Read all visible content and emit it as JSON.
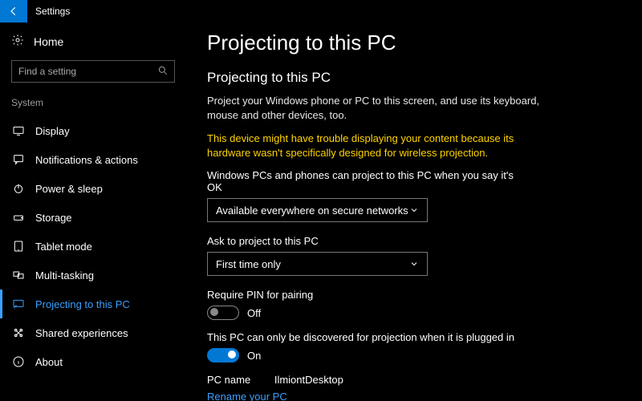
{
  "titlebar": {
    "app_title": "Settings"
  },
  "sidebar": {
    "home_label": "Home",
    "search_placeholder": "Find a setting",
    "category_label": "System",
    "items": [
      {
        "label": "Display"
      },
      {
        "label": "Notifications & actions"
      },
      {
        "label": "Power & sleep"
      },
      {
        "label": "Storage"
      },
      {
        "label": "Tablet mode"
      },
      {
        "label": "Multi-tasking"
      },
      {
        "label": "Projecting to this PC"
      },
      {
        "label": "Shared experiences"
      },
      {
        "label": "About"
      }
    ]
  },
  "main": {
    "page_title": "Projecting to this PC",
    "section_title": "Projecting to this PC",
    "intro": "Project your Windows phone or PC to this screen, and use its keyboard, mouse and other devices, too.",
    "warning": "This device might have trouble displaying your content because its hardware wasn't specifically designed for wireless projection.",
    "availability_label": "Windows PCs and phones can project to this PC when you say it's OK",
    "availability_value": "Available everywhere on secure networks",
    "ask_label": "Ask to project to this PC",
    "ask_value": "First time only",
    "pin_label": "Require PIN for pairing",
    "pin_value": "Off",
    "plugged_label": "This PC can only be discovered for projection when it is plugged in",
    "plugged_value": "On",
    "pc_name_label": "PC name",
    "pc_name_value": "IlmiontDesktop",
    "rename_link": "Rename your PC"
  }
}
